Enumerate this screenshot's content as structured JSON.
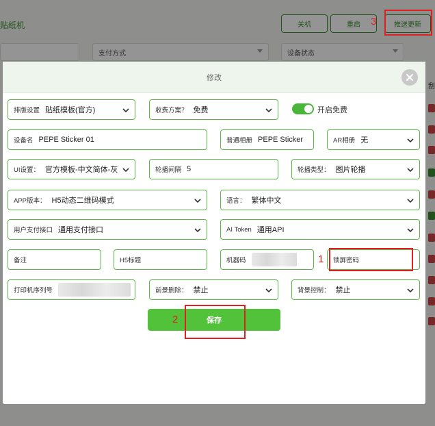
{
  "page": {
    "title": "贴纸机",
    "buttons": {
      "shutdown": "关机",
      "restart": "重启",
      "push_update": "推送更新"
    },
    "filters": {
      "payment_method": "支付方式",
      "device_status": "设备状态"
    },
    "right_edge_text": "刮"
  },
  "annotations": {
    "one": "1",
    "two": "2",
    "three": "3"
  },
  "modal": {
    "title": "修改",
    "layout_setting": {
      "label": "排版设置",
      "value": "贴纸模板(官方)"
    },
    "charge_plan": {
      "label": "收费方案？",
      "value": "免费"
    },
    "free_toggle": {
      "label": "开启免费",
      "on": true
    },
    "device_name": {
      "label": "设备名",
      "value": "PEPE Sticker  01"
    },
    "normal_album": {
      "label": "普通相册",
      "value": "PEPE Sticker"
    },
    "ar_album": {
      "label": "AR相册",
      "value": "无"
    },
    "ui_setting": {
      "label": "UI设置：",
      "value": "官方模板-中文简体-灰"
    },
    "carousel_interval": {
      "label": "轮播间隔",
      "value": "5"
    },
    "carousel_type": {
      "label": "轮播类型：",
      "value": "图片轮播"
    },
    "app_version": {
      "label": "APP版本：",
      "value": "H5动态二维码模式"
    },
    "language": {
      "label": "语言：",
      "value": "繁体中文"
    },
    "user_payment": {
      "label": "用户支付接口",
      "value": "通用支付接口"
    },
    "ai_token": {
      "label": "AI Token",
      "value": "通用API"
    },
    "remark": {
      "label": "备注"
    },
    "h5_title": {
      "label": "H5标题"
    },
    "machine_code": {
      "label": "机器码"
    },
    "lock_password": {
      "label": "锁屏密码"
    },
    "printer_serial": {
      "label": "打印机序列号"
    },
    "foreground_delete": {
      "label": "前景删除：",
      "value": "禁止"
    },
    "background_control": {
      "label": "背景控制：",
      "value": "禁止"
    },
    "save_label": "保存"
  },
  "colors": {
    "accent": "#52c23a",
    "border": "#5ab945",
    "annotation": "#e02020"
  }
}
